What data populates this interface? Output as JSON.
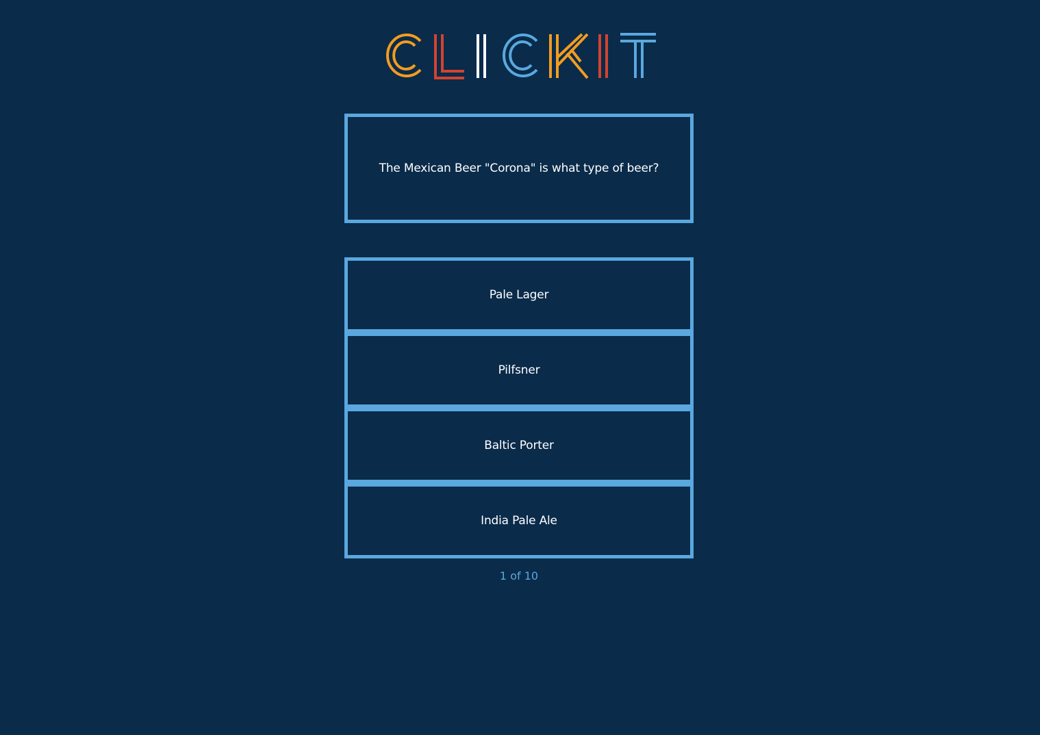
{
  "logo": {
    "text": "CLICKIT",
    "colors": {
      "orange": "#f39c1f",
      "red": "#d2432f",
      "white": "#ffffff",
      "blue": "#5aa8df"
    }
  },
  "question": {
    "text": "The Mexican Beer \"Corona\" is what type of beer?"
  },
  "answers": [
    {
      "label": "Pale Lager"
    },
    {
      "label": "Pilfsner"
    },
    {
      "label": "Baltic Porter"
    },
    {
      "label": "India Pale Ale"
    }
  ],
  "progress": {
    "text": "1 of 10",
    "current": 1,
    "total": 10
  },
  "theme": {
    "background": "#0a2b4a",
    "accent": "#5aa8df",
    "text": "#ffffff"
  }
}
